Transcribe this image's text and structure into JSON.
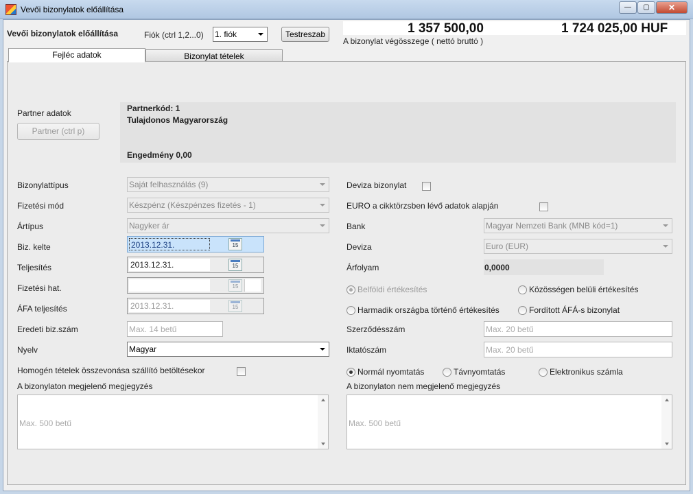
{
  "window": {
    "title": "Vevői bizonylatok előállítása",
    "min": "—",
    "max": "▢",
    "close": "✕"
  },
  "header": {
    "title": "Vevői bizonylatok előállítása",
    "fiok_label": "Fiók (ctrl 1,2...0)",
    "fiok_value": "1. fiók",
    "customize_button": "Testreszab",
    "net_total": "1 357 500,00",
    "gross_total": "1 724 025,00 HUF",
    "total_caption": "A bizonylat végösszege ( nettó bruttó )"
  },
  "tabs": [
    {
      "label": "Fejléc adatok",
      "active": true
    },
    {
      "label": "Bizonylat tételek",
      "active": false
    }
  ],
  "partner": {
    "section_label": "Partner adatok",
    "button_label": "Partner (ctrl p)",
    "code": "Partnerkód: 1",
    "name": "Tulajdonos Magyarország",
    "discount": "Engedmény 0,00"
  },
  "left_fields": {
    "doc_type_label": "Bizonylattípus",
    "doc_type_value": "Saját felhasználás (9)",
    "payment_label": "Fizetési mód",
    "payment_value": "Készpénz (Készpénzes fizetés - 1)",
    "price_type_label": "Ártípus",
    "price_type_value": "Nagyker ár",
    "issue_date_label": "Biz. kelte",
    "issue_date_value": "2013.12.31.",
    "fulfillment_label": "Teljesítés",
    "fulfillment_value": "2013.12.31.",
    "due_label": "Fizetési hat.",
    "due_value": "",
    "vat_label": "ÁFA teljesítés",
    "vat_value": "2013.12.31.",
    "orig_label": "Eredeti biz.szám",
    "orig_placeholder": "Max. 14 betű",
    "lang_label": "Nyelv",
    "lang_value": "Magyar",
    "homogen_label": "Homogén tételek összevonása szállító betöltésekor",
    "note_label": "A bizonylaton megjelenő megjegyzés",
    "note_placeholder": "Max. 500 betű",
    "calendar_glyph": "15"
  },
  "right_fields": {
    "currency_doc_label": "Deviza bizonylat",
    "euro_label": "EURO a cikktörzsben lévő adatok alapján",
    "bank_label": "Bank",
    "bank_value": "Magyar Nemzeti Bank (MNB kód=1)",
    "currency_label": "Deviza",
    "currency_value": "Euro (EUR)",
    "rate_label": "Árfolyam",
    "rate_value": "0,0000",
    "sale_domestic": "Belföldi értékesítés",
    "sale_community": "Közösségen belüli értékesítés",
    "sale_third": "Harmadik országba történő értékesítés",
    "sale_reverse": "Fordított ÁFÁ-s bizonylat",
    "contract_label": "Szerződésszám",
    "contract_placeholder": "Max. 20 betű",
    "filing_label": "Iktatószám",
    "filing_placeholder": "Max. 20 betű",
    "print_normal": "Normál nyomtatás",
    "print_remote": "Távnyomtatás",
    "print_electronic": "Elektronikus számla",
    "hidden_note_label": "A bizonylaton nem megjelenő megjegyzés",
    "hidden_note_placeholder": "Max. 500 betű"
  }
}
